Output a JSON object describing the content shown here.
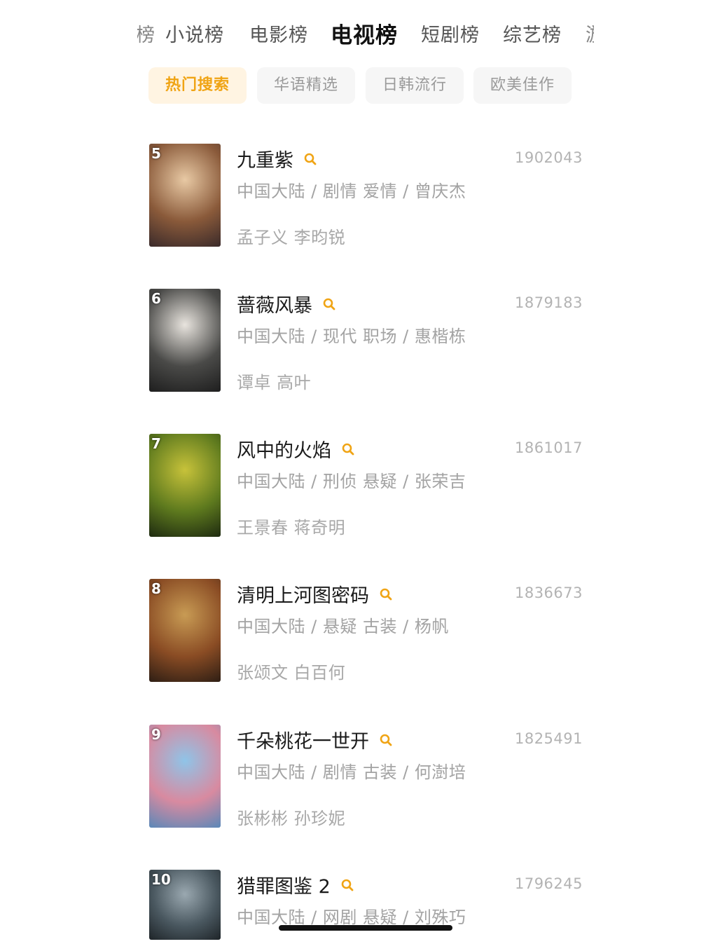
{
  "top_tabs": [
    {
      "label": "小说榜",
      "active": false
    },
    {
      "label": "电影榜",
      "active": false
    },
    {
      "label": "电视榜",
      "active": true
    },
    {
      "label": "短剧榜",
      "active": false
    },
    {
      "label": "综艺榜",
      "active": false
    }
  ],
  "filter_chips": [
    {
      "label": "热门搜索",
      "active": true
    },
    {
      "label": "华语精选",
      "active": false
    },
    {
      "label": "日韩流行",
      "active": false
    },
    {
      "label": "欧美佳作",
      "active": false
    }
  ],
  "items": [
    {
      "rank": "5",
      "title": "九重紫",
      "score": "1902043",
      "meta": "中国大陆 / 剧情 爱情 / 曾庆杰",
      "cast": "孟子义 李昀锐",
      "poster_colors": [
        "#e8c9a4",
        "#8a5a3a",
        "#3a2a2a"
      ]
    },
    {
      "rank": "6",
      "title": "蔷薇风暴",
      "score": "1879183",
      "meta": "中国大陆 / 现代 职场 / 惠楷栋",
      "cast": "谭卓 高叶",
      "poster_colors": [
        "#e8e4de",
        "#4a4a48",
        "#1e1e1e"
      ]
    },
    {
      "rank": "7",
      "title": "风中的火焰",
      "score": "1861017",
      "meta": "中国大陆 / 刑侦 悬疑 / 张荣吉",
      "cast": "王景春 蒋奇明",
      "poster_colors": [
        "#c7c23a",
        "#5e7a1e",
        "#1e2a10"
      ]
    },
    {
      "rank": "8",
      "title": "清明上河图密码",
      "score": "1836673",
      "meta": "中国大陆 / 悬疑 古装 / 杨帆",
      "cast": "张颂文 白百何",
      "poster_colors": [
        "#c89b54",
        "#8a4c24",
        "#2e1e14"
      ]
    },
    {
      "rank": "9",
      "title": "千朵桃花一世开",
      "score": "1825491",
      "meta": "中国大陆 / 剧情 古装 / 何澍培",
      "cast": "张彬彬 孙珍妮",
      "poster_colors": [
        "#8fc4e8",
        "#d88aa0",
        "#5a88b8"
      ]
    },
    {
      "rank": "10",
      "title": "猎罪图鉴 2",
      "score": "1796245",
      "meta": "中国大陆 / 网剧 悬疑 / 刘殊巧",
      "cast": "",
      "poster_colors": [
        "#9aa8b0",
        "#4a5860",
        "#1e2428"
      ]
    }
  ],
  "colors": {
    "accent": "#f0a414",
    "chip_active_bg": "#fff4e2"
  },
  "icons": {
    "search": "search-icon"
  }
}
